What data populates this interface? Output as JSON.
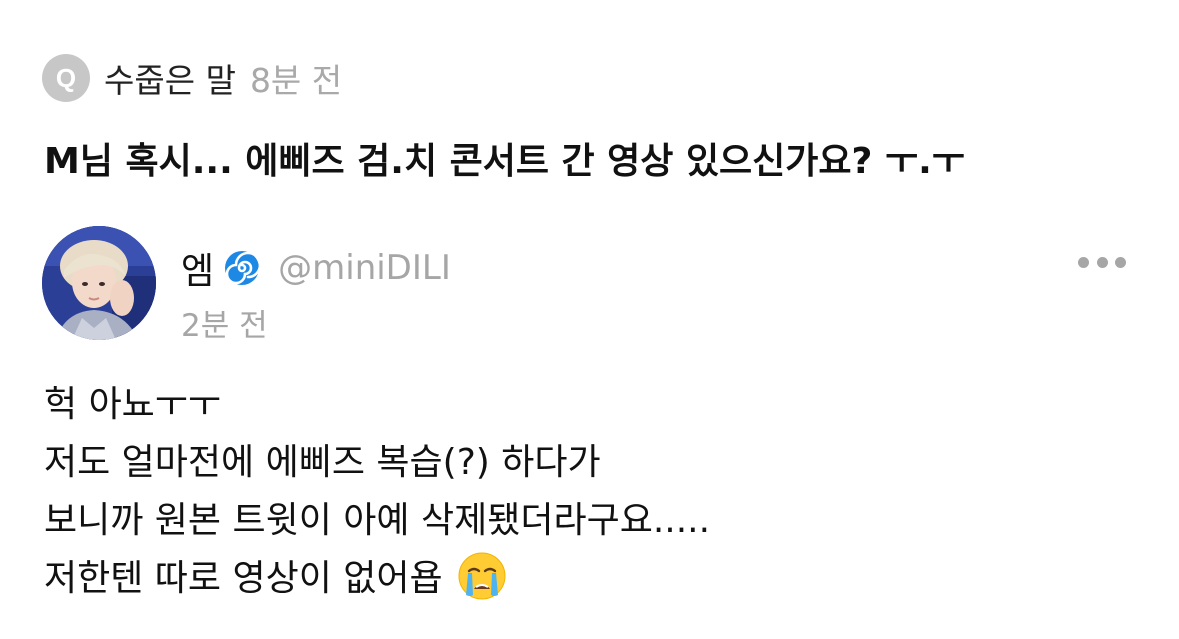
{
  "question": {
    "badge_letter": "Q",
    "asker_name": "수줍은 말",
    "time": "8분 전",
    "text": "M님 혹시... 에삐즈 검.치 콘서트 간 영상 있으신가요? ㅜ.ㅜ"
  },
  "reply": {
    "author_name": "엠",
    "author_emoji": "swirl-icon",
    "handle": "@miniDILI",
    "time": "2분 전",
    "lines": [
      "헉 아뇨ㅜㅜ",
      "저도 얼마전에 에삐즈 복습(?) 하다가",
      "보니까 원본 트윗이 아예 삭제됐더라구요.....",
      "저한텐 따로 영상이 없어욥"
    ],
    "trailing_emoji": "loudly-crying-face-icon"
  },
  "colors": {
    "badge_bg": "#c7c7c7",
    "muted_text": "#a6a6a6",
    "primary_text": "#111111",
    "swirl_blue": "#1e88e5"
  }
}
